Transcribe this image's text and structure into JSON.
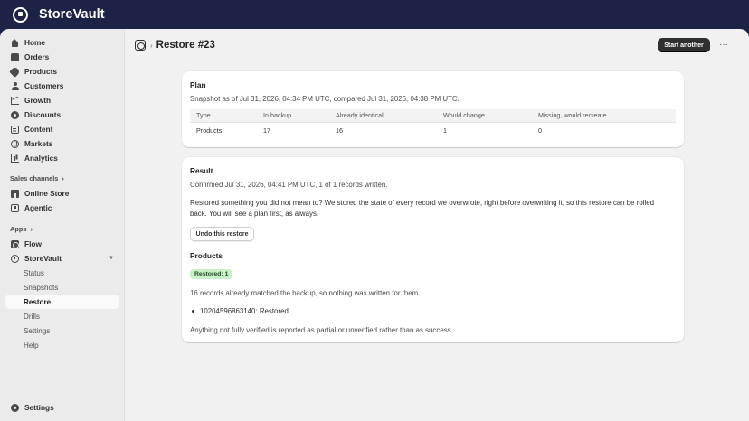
{
  "app": {
    "brand": "StoreVault"
  },
  "sidebar": {
    "main": [
      {
        "label": "Home",
        "icon": "home-icon"
      },
      {
        "label": "Orders",
        "icon": "orders-icon"
      },
      {
        "label": "Products",
        "icon": "tag-icon"
      },
      {
        "label": "Customers",
        "icon": "person-icon"
      },
      {
        "label": "Growth",
        "icon": "growth-icon"
      },
      {
        "label": "Discounts",
        "icon": "discount-icon"
      },
      {
        "label": "Content",
        "icon": "content-icon"
      },
      {
        "label": "Markets",
        "icon": "globe-icon"
      },
      {
        "label": "Analytics",
        "icon": "analytics-icon"
      }
    ],
    "sales_channels_label": "Sales channels",
    "sales_channels": [
      {
        "label": "Online Store",
        "icon": "store-icon"
      },
      {
        "label": "Agentic",
        "icon": "agentic-icon"
      }
    ],
    "apps_label": "Apps",
    "apps": [
      {
        "label": "Flow",
        "icon": "flow-icon"
      },
      {
        "label": "StoreVault",
        "icon": "storevault-icon"
      }
    ],
    "storevault_sub": [
      {
        "label": "Status",
        "active": false
      },
      {
        "label": "Snapshots",
        "active": false
      },
      {
        "label": "Restore",
        "active": true
      },
      {
        "label": "Drills",
        "active": false
      },
      {
        "label": "Settings",
        "active": false
      },
      {
        "label": "Help",
        "active": false
      }
    ],
    "settings_label": "Settings"
  },
  "header": {
    "title": "Restore #23",
    "primary_action": "Start another",
    "more": "···"
  },
  "plan": {
    "title": "Plan",
    "snapshot_text": "Snapshot as of Jul 31, 2026, 04:34 PM UTC, compared Jul 31, 2026, 04:38 PM UTC.",
    "columns": [
      "Type",
      "In backup",
      "Already identical",
      "Would change",
      "Missing, would recreate"
    ],
    "rows": [
      [
        "Products",
        "17",
        "16",
        "1",
        "0"
      ]
    ]
  },
  "result": {
    "title": "Result",
    "confirmed_text": "Confirmed Jul 31, 2026, 04:41 PM UTC, 1 of 1 records written.",
    "restored_note_line1": "Restored something you did not mean to? We stored the state of every record we overwrote, right before overwriting it, so this restore can be rolled",
    "restored_note_line2": "back. You will see a plan first, as always.",
    "undo_button": "Undo this restore",
    "products_title": "Products",
    "badge": "Restored: 1",
    "matched_text": "16 records already matched the backup, so nothing was written for them.",
    "records": [
      "10204596863140: Restored"
    ],
    "footer_note": "Anything not fully verified is reported as partial or unverified rather than as success."
  },
  "colors": {
    "topbar": "#1c2346",
    "badge_bg": "#c9f0c8",
    "primary_button": "#303030"
  }
}
